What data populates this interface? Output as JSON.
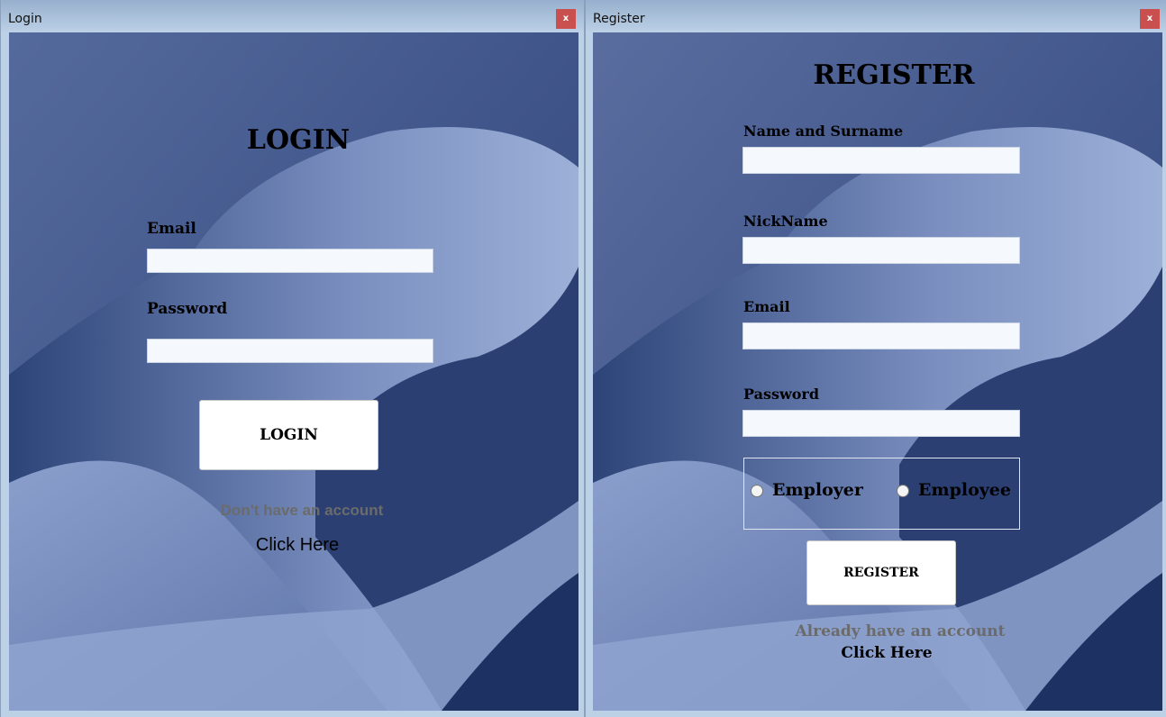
{
  "login_window": {
    "title": "Login",
    "close_label": "x",
    "heading": "LOGIN",
    "email_label": "Email",
    "email_value": "",
    "password_label": "Password",
    "password_value": "",
    "login_button": "LOGIN",
    "no_account_text": "Don't have an account",
    "click_here": "Click Here"
  },
  "register_window": {
    "title": "Register",
    "close_label": "x",
    "heading": "REGISTER",
    "name_label": "Name and Surname",
    "nickname_label": "NickName",
    "email_label": "Email",
    "password_label": "Password",
    "role_options": [
      "Employer",
      "Employee"
    ],
    "register_button": "REGISTER",
    "have_account_text": "Already have an account",
    "click_here": "Click Here"
  }
}
